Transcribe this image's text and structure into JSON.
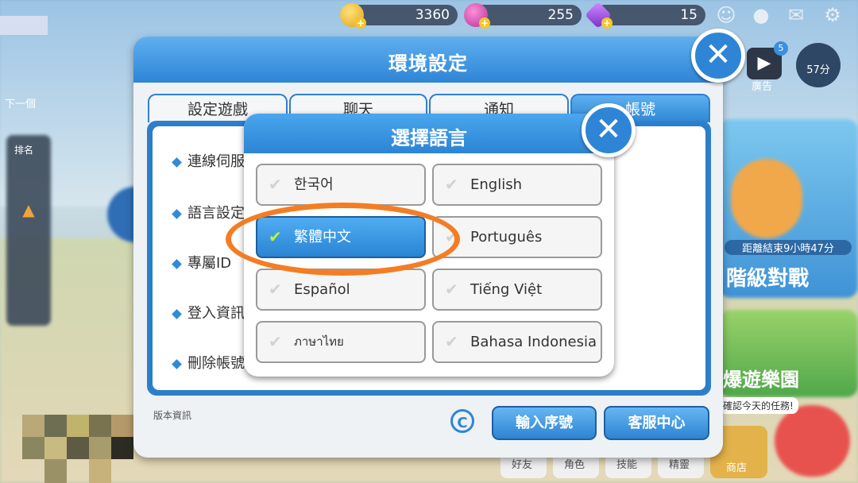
{
  "currencies": [
    {
      "name": "gold-coin-icon",
      "value": "3360",
      "color": "#f3c230"
    },
    {
      "name": "candy-icon",
      "value": "255",
      "color": "#d04ab0"
    },
    {
      "name": "gem-icon",
      "value": "15",
      "color": "#a54ee0"
    }
  ],
  "top_icons": [
    "friends-icon",
    "chat-icon",
    "mail-icon",
    "settings-gear-icon"
  ],
  "side_widgets": {
    "ad_label": "廣告",
    "ad_badge": "5",
    "timer": "57分",
    "rank_label": "排名",
    "event_timer": "距離結束9小時47分",
    "ranked_battle": "階級對戰",
    "explore_park": "爆遊樂園",
    "today_mission": "確認今天的任務!",
    "next_label": "下一個"
  },
  "bottom_nav": [
    "好友",
    "角色",
    "技能",
    "精靈",
    "商店"
  ],
  "settings": {
    "title": "環境設定",
    "tabs": [
      "設定遊戲",
      "聊天",
      "通知",
      "帳號"
    ],
    "active_tab": 3,
    "menu": [
      "連線伺服",
      "語言設定",
      "專屬ID",
      "登入資訊",
      "刪除帳號"
    ],
    "version_label": "版本資訊",
    "buttons": {
      "serial": "輸入序號",
      "support": "客服中心"
    }
  },
  "language_dialog": {
    "title": "選擇語言",
    "options": [
      {
        "label": "한국어",
        "selected": false
      },
      {
        "label": "English",
        "selected": false
      },
      {
        "label": "繁體中文",
        "selected": true
      },
      {
        "label": "Português",
        "selected": false
      },
      {
        "label": "Español",
        "selected": false
      },
      {
        "label": "Tiếng Việt",
        "selected": false
      },
      {
        "label": "ภาษาไทย",
        "selected": false
      },
      {
        "label": "Bahasa Indonesia",
        "selected": false
      }
    ],
    "check_glyph": "✔"
  },
  "colors": {
    "accent": "#2e86d4",
    "highlight": "#f47d24",
    "selected_check": "#b9f53a"
  }
}
